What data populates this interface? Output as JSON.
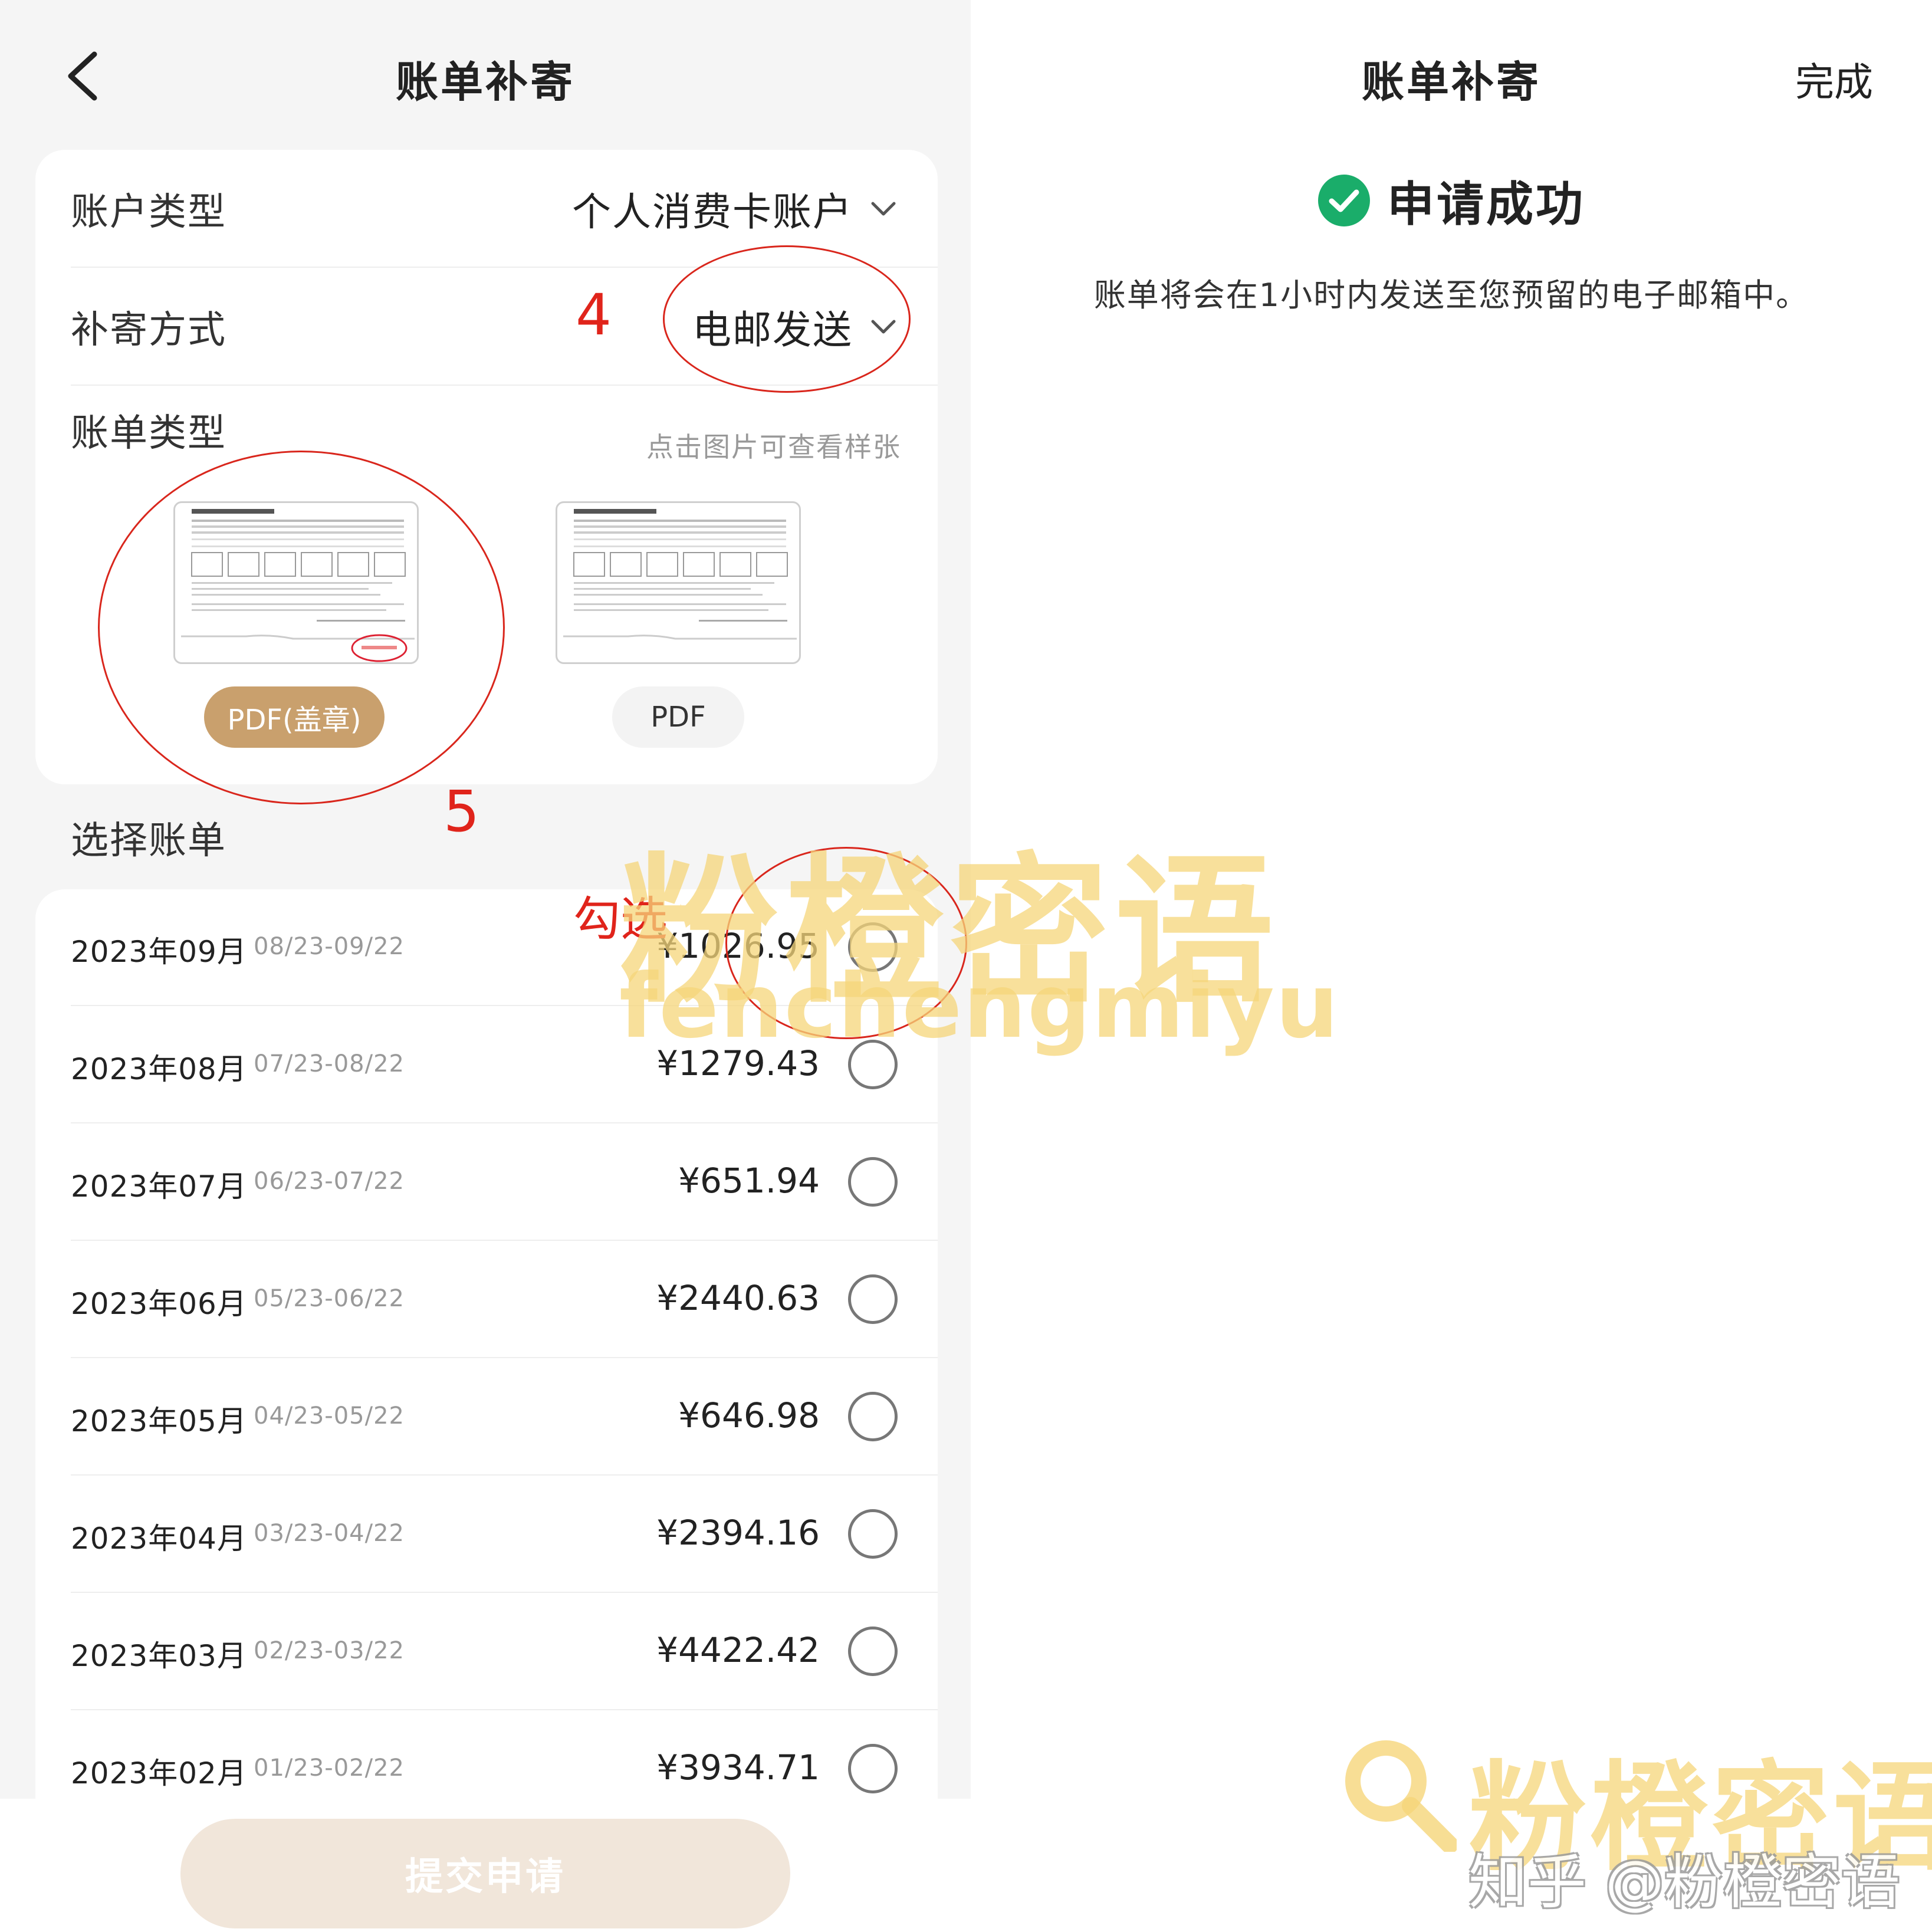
{
  "left": {
    "nav_title": "账单补寄",
    "account_type": {
      "label": "账户类型",
      "value": "个人消费卡账户"
    },
    "delivery_method": {
      "label": "补寄方式",
      "value": "电邮发送"
    },
    "bill_type": {
      "label": "账单类型",
      "hint": "点击图片可查看样张",
      "options": [
        {
          "label": "PDF(盖章)",
          "selected": true
        },
        {
          "label": "PDF",
          "selected": false
        }
      ]
    },
    "select_bill_title": "选择账单",
    "bills": [
      {
        "month": "2023年09月",
        "range": "08/23-09/22",
        "amount": "¥1026.95",
        "checked": false
      },
      {
        "month": "2023年08月",
        "range": "07/23-08/22",
        "amount": "¥1279.43",
        "checked": false
      },
      {
        "month": "2023年07月",
        "range": "06/23-07/22",
        "amount": "¥651.94",
        "checked": false
      },
      {
        "month": "2023年06月",
        "range": "05/23-06/22",
        "amount": "¥2440.63",
        "checked": false
      },
      {
        "month": "2023年05月",
        "range": "04/23-05/22",
        "amount": "¥646.98",
        "checked": false
      },
      {
        "month": "2023年04月",
        "range": "03/23-04/22",
        "amount": "¥2394.16",
        "checked": false
      },
      {
        "month": "2023年03月",
        "range": "02/23-03/22",
        "amount": "¥4422.42",
        "checked": false
      },
      {
        "month": "2023年02月",
        "range": "01/23-02/22",
        "amount": "¥3934.71",
        "checked": false
      }
    ],
    "submit_label": "提交申请"
  },
  "annotations": {
    "step4": "4",
    "step5": "5",
    "check": "勾选"
  },
  "right": {
    "nav_title": "账单补寄",
    "done_label": "完成",
    "success_title": "申请成功",
    "success_message": "账单将会在1小时内发送至您预留的电子邮箱中。"
  },
  "watermark": {
    "brand_cn": "粉橙密语",
    "brand_pinyin": "fenchengmiyu",
    "zhihu": "知乎 @粉橙密语"
  },
  "colors": {
    "accent": "#c9a06d",
    "success_green": "#1aad6a",
    "annotation_red": "#e0241b",
    "watermark_yellow": "#f6d67a"
  },
  "icons": {
    "back": "chevron-left-icon",
    "dropdown": "chevron-down-icon",
    "success": "check-circle-icon",
    "search": "search-icon"
  }
}
